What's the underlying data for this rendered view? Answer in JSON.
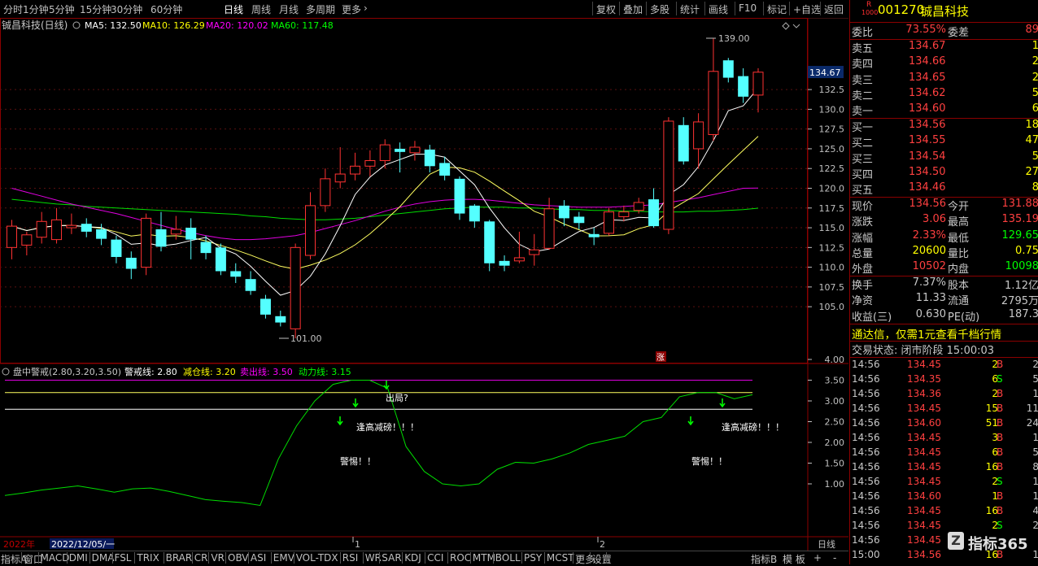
{
  "toolbar": {
    "left": [
      "分时",
      "1分钟",
      "5分钟",
      "15分钟",
      "30分钟",
      "60分钟",
      "日线",
      "周线",
      "月线",
      "多周期",
      "更多"
    ],
    "active": "日线",
    "right": [
      "复权",
      "叠加",
      "多股",
      "统计",
      "画线",
      "F10",
      "标记",
      "+自选",
      "返回"
    ]
  },
  "main_chart": {
    "title": "铖昌科技(日线)",
    "indicators": [
      {
        "label": "MA5: 132.50",
        "color": "#ffffff"
      },
      {
        "label": "MA10: 126.29",
        "color": "#ffff00"
      },
      {
        "label": "MA20: 120.02",
        "color": "#ff00ff"
      },
      {
        "label": "MA60: 117.48",
        "color": "#00ff00"
      }
    ],
    "high_label": "139.00",
    "low_label": "101.00",
    "price_tag": "134.67",
    "zhang_mark": "涨",
    "y_ticks": [
      "132.5",
      "130.0",
      "127.5",
      "125.0",
      "122.5",
      "120.0",
      "117.5",
      "115.0",
      "112.5",
      "110.0",
      "107.5",
      "105.0"
    ]
  },
  "chart_data": [
    {
      "type": "candlestick",
      "title": "铖昌科技(日线)",
      "ylim": [
        101,
        139
      ],
      "candles": [
        {
          "o": 112.5,
          "c": 115.2,
          "h": 116,
          "l": 111
        },
        {
          "o": 112.8,
          "c": 114.1,
          "h": 114.5,
          "l": 111.5
        },
        {
          "o": 113.8,
          "c": 115.8,
          "h": 117.0,
          "l": 113.0
        },
        {
          "o": 113.5,
          "c": 116.0,
          "h": 117.5,
          "l": 113.0
        },
        {
          "o": 115.0,
          "c": 115.3,
          "h": 116.8,
          "l": 114.2
        },
        {
          "o": 115.5,
          "c": 114.5,
          "h": 116.2,
          "l": 113.8
        },
        {
          "o": 114.8,
          "c": 113.6,
          "h": 115.5,
          "l": 112.8
        },
        {
          "o": 113.5,
          "c": 111.3,
          "h": 114.0,
          "l": 110.5
        },
        {
          "o": 111.2,
          "c": 109.8,
          "h": 112.0,
          "l": 108.5
        },
        {
          "o": 110.0,
          "c": 116.2,
          "h": 116.8,
          "l": 109.0
        },
        {
          "o": 114.8,
          "c": 112.6,
          "h": 117.0,
          "l": 112.0
        },
        {
          "o": 114.2,
          "c": 114.8,
          "h": 116.5,
          "l": 113.5
        },
        {
          "o": 115.0,
          "c": 113.5,
          "h": 116.2,
          "l": 111.0
        },
        {
          "o": 113.2,
          "c": 111.8,
          "h": 114.0,
          "l": 111.0
        },
        {
          "o": 112.5,
          "c": 109.5,
          "h": 113.0,
          "l": 109.0
        },
        {
          "o": 109.5,
          "c": 108.8,
          "h": 110.5,
          "l": 108.0
        },
        {
          "o": 108.5,
          "c": 107.0,
          "h": 109.5,
          "l": 106.5
        },
        {
          "o": 106.0,
          "c": 104.0,
          "h": 106.5,
          "l": 103.5
        },
        {
          "o": 103.8,
          "c": 103.0,
          "h": 104.5,
          "l": 102.5
        },
        {
          "o": 102.2,
          "c": 112.5,
          "h": 113.0,
          "l": 101.0
        },
        {
          "o": 111.5,
          "c": 117.8,
          "h": 119.5,
          "l": 111.0
        },
        {
          "o": 117.8,
          "c": 121.2,
          "h": 122.5,
          "l": 117.0
        },
        {
          "o": 120.8,
          "c": 121.8,
          "h": 125.2,
          "l": 120.0
        },
        {
          "o": 121.8,
          "c": 122.8,
          "h": 124.5,
          "l": 121.0
        },
        {
          "o": 122.8,
          "c": 123.5,
          "h": 124.8,
          "l": 121.5
        },
        {
          "o": 123.5,
          "c": 125.5,
          "h": 126.2,
          "l": 122.5
        },
        {
          "o": 125.0,
          "c": 124.6,
          "h": 125.8,
          "l": 122.0
        },
        {
          "o": 124.5,
          "c": 125.2,
          "h": 126.0,
          "l": 123.5
        },
        {
          "o": 124.9,
          "c": 122.8,
          "h": 125.5,
          "l": 122.0
        },
        {
          "o": 123.2,
          "c": 121.6,
          "h": 124.0,
          "l": 121.0
        },
        {
          "o": 121.2,
          "c": 116.8,
          "h": 121.5,
          "l": 116.0
        },
        {
          "o": 117.8,
          "c": 115.8,
          "h": 118.0,
          "l": 115.0
        },
        {
          "o": 115.8,
          "c": 110.5,
          "h": 116.0,
          "l": 109.5
        },
        {
          "o": 110.8,
          "c": 110.2,
          "h": 111.5,
          "l": 109.5
        },
        {
          "o": 110.8,
          "c": 111.2,
          "h": 114.5,
          "l": 110.5
        },
        {
          "o": 111.6,
          "c": 112.2,
          "h": 114.2,
          "l": 110.2
        },
        {
          "o": 112.4,
          "c": 117.4,
          "h": 118.8,
          "l": 112.2
        },
        {
          "o": 117.8,
          "c": 116.2,
          "h": 118.5,
          "l": 115.2
        },
        {
          "o": 116.4,
          "c": 115.6,
          "h": 117.0,
          "l": 114.8
        },
        {
          "o": 114.2,
          "c": 113.8,
          "h": 115.0,
          "l": 112.8
        },
        {
          "o": 114.3,
          "c": 117.0,
          "h": 117.5,
          "l": 114.0
        },
        {
          "o": 116.4,
          "c": 117.0,
          "h": 117.8,
          "l": 115.8
        },
        {
          "o": 117.2,
          "c": 118.2,
          "h": 118.8,
          "l": 116.8
        },
        {
          "o": 118.6,
          "c": 115.2,
          "h": 120.0,
          "l": 115.0
        },
        {
          "o": 114.8,
          "c": 128.5,
          "h": 129.0,
          "l": 114.2
        },
        {
          "o": 128.0,
          "c": 123.4,
          "h": 129.0,
          "l": 123.0
        },
        {
          "o": 125.0,
          "c": 128.4,
          "h": 129.5,
          "l": 122.5
        },
        {
          "o": 126.8,
          "c": 134.8,
          "h": 139.0,
          "l": 126.0
        },
        {
          "o": 136.2,
          "c": 134.0,
          "h": 136.5,
          "l": 133.4
        },
        {
          "o": 134.2,
          "c": 131.6,
          "h": 135.2,
          "l": 130.8
        },
        {
          "o": 131.8,
          "c": 134.7,
          "h": 135.2,
          "l": 129.6
        }
      ]
    },
    {
      "type": "line",
      "title": "盘中警戒(2.80,3.20,3.50)",
      "ylim": [
        0.5,
        4.0
      ],
      "series": [
        {
          "name": "警戒线",
          "values": [
            2.8
          ]
        },
        {
          "name": "减仓线",
          "values": [
            3.2
          ]
        },
        {
          "name": "卖出线",
          "values": [
            3.5
          ]
        },
        {
          "name": "动力线",
          "values": [
            0.72,
            0.78,
            0.85,
            0.9,
            0.95,
            0.88,
            0.8,
            0.88,
            0.9,
            0.82,
            0.72,
            0.62,
            0.58,
            0.55,
            0.48,
            1.6,
            2.4,
            3.0,
            3.4,
            3.5,
            3.5,
            3.3,
            1.9,
            1.3,
            1.0,
            0.95,
            1.0,
            1.35,
            1.52,
            1.5,
            1.6,
            1.75,
            1.95,
            2.05,
            2.15,
            2.5,
            2.6,
            3.1,
            3.2,
            3.2,
            3.05,
            3.15
          ]
        }
      ]
    }
  ],
  "sub_chart": {
    "title": "盘中警戒(2.80,3.20,3.50)",
    "labels": [
      {
        "text": "警戒线: 2.80",
        "color": "#ffffff"
      },
      {
        "text": "减仓线: 3.20",
        "color": "#ffff00"
      },
      {
        "text": "卖出线: 3.50",
        "color": "#ff00ff"
      },
      {
        "text": "动力线: 3.15",
        "color": "#00ff00"
      }
    ],
    "annotations": [
      "出局?",
      "逢高减磅！！！",
      "警惕！！",
      "逢高减磅！！！",
      "警惕！！"
    ],
    "y_ticks": [
      "4.00",
      "3.50",
      "3.00",
      "2.50",
      "2.00",
      "1.50",
      "1.00"
    ]
  },
  "date_axis": {
    "year": "2022年",
    "date": "2022/12/05/一",
    "marks": [
      "1",
      "2"
    ],
    "period": "日线"
  },
  "bottom_tabs": [
    "指标A",
    "窗口",
    "MACD",
    "DMI",
    "DMA",
    "FSL",
    "TRIX",
    "BRAR",
    "CR",
    "VR",
    "OBV",
    "ASI",
    "EMV",
    "VOL-TDX",
    "RSI",
    "WR",
    "SAR",
    "KDJ",
    "CCI",
    "ROC",
    "MTM",
    "BOLL",
    "PSY",
    "MCST",
    "更多",
    "设置"
  ],
  "bottom_right_tabs": [
    "指标B",
    "模 板",
    "+",
    "-"
  ],
  "quote": {
    "code": "001270",
    "name": "铖昌科技",
    "r_label": "R",
    "r_sub": "1000",
    "webi_label": "委比",
    "webi": "73.55%",
    "weicha_label": "委差",
    "weicha": "89",
    "asks": [
      [
        "卖五",
        "134.67",
        "1"
      ],
      [
        "卖四",
        "134.66",
        "2"
      ],
      [
        "卖三",
        "134.65",
        "2"
      ],
      [
        "卖二",
        "134.62",
        "5"
      ],
      [
        "卖一",
        "134.60",
        "6"
      ]
    ],
    "bids": [
      [
        "买一",
        "134.56",
        "18"
      ],
      [
        "买二",
        "134.55",
        "47"
      ],
      [
        "买三",
        "134.54",
        "5"
      ],
      [
        "买四",
        "134.50",
        "27"
      ],
      [
        "买五",
        "134.46",
        "8"
      ]
    ],
    "stats": [
      [
        "现价",
        "134.56",
        "今开",
        "131.88"
      ],
      [
        "涨跌",
        "3.06",
        "最高",
        "135.19"
      ],
      [
        "涨幅",
        "2.33%",
        "最低",
        "129.65"
      ],
      [
        "总量",
        "20600",
        "量比",
        "0.75"
      ],
      [
        "外盘",
        "10502",
        "内盘",
        "10098"
      ]
    ],
    "fin": [
      [
        "换手",
        "7.37%",
        "股本",
        "1.12亿"
      ],
      [
        "净资",
        "11.33",
        "流通",
        "2795万"
      ],
      [
        "收益(三)",
        "0.630",
        "PE(动)",
        "187.3"
      ]
    ],
    "promo": "通达信，仅需1元查看千档行情",
    "status": "交易状态: 闭市阶段 15:00:03",
    "ticks": [
      [
        "14:56",
        "134.45",
        "2",
        "B",
        "2"
      ],
      [
        "14:56",
        "134.35",
        "6",
        "S",
        "5"
      ],
      [
        "14:56",
        "134.36",
        "2",
        "B",
        "1"
      ],
      [
        "14:56",
        "134.45",
        "15",
        "B",
        "11"
      ],
      [
        "14:56",
        "134.60",
        "51",
        "B",
        "24"
      ],
      [
        "14:56",
        "134.45",
        "3",
        "B",
        "1"
      ],
      [
        "14:56",
        "134.45",
        "6",
        "B",
        "5"
      ],
      [
        "14:56",
        "134.45",
        "16",
        "B",
        "8"
      ],
      [
        "14:56",
        "134.45",
        "2",
        "S",
        "1"
      ],
      [
        "14:56",
        "134.60",
        "1",
        "B",
        "1"
      ],
      [
        "14:56",
        "134.45",
        "16",
        "B",
        "4"
      ],
      [
        "14:56",
        "134.45",
        "2",
        "S",
        "2"
      ],
      [
        "14:56",
        "134.45",
        "",
        "",
        " "
      ],
      [
        "15:00",
        "134.56",
        "16",
        "B",
        "1"
      ]
    ],
    "watermark": "指标365"
  }
}
